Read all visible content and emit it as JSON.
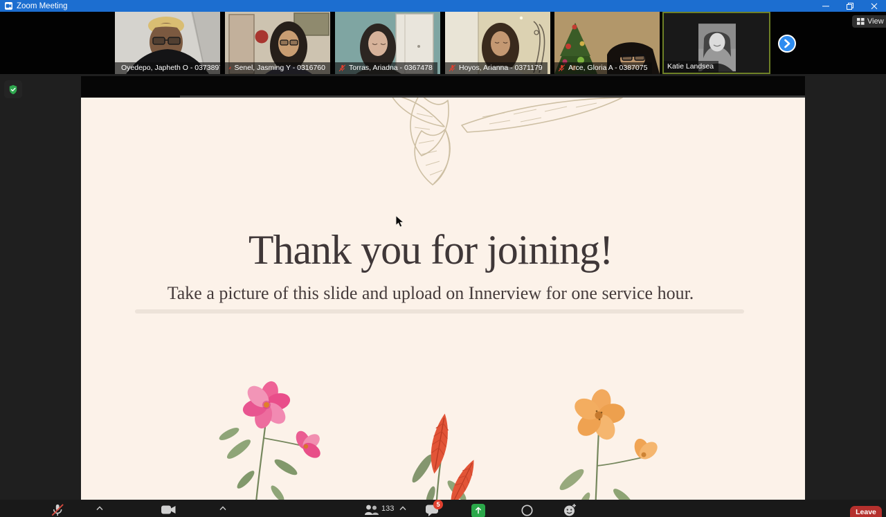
{
  "window": {
    "title": "Zoom Meeting"
  },
  "filmstrip": {
    "view_label": "View",
    "participants": [
      {
        "name": "Oyedepo, Japheth O - 0373897",
        "muted": true,
        "active_speaker": false
      },
      {
        "name": "Senel, Jasming Y - 0316760",
        "muted": true,
        "active_speaker": false
      },
      {
        "name": "Torras, Ariadna - 0367478",
        "muted": true,
        "active_speaker": false
      },
      {
        "name": "Hoyos, Arianna - 0371179",
        "muted": true,
        "active_speaker": false
      },
      {
        "name": "Arce, Gloria A - 0387075",
        "muted": true,
        "active_speaker": false
      },
      {
        "name": "Katie Landsea",
        "muted": false,
        "active_speaker": true
      }
    ]
  },
  "slide": {
    "title": "Thank you for joining!",
    "subtitle": "Take a picture of this slide and upload on Innerview for one service hour."
  },
  "toolbar": {
    "participants_count": "133",
    "chat_badge_count": "5",
    "leave_label": "Leave"
  },
  "icons": [
    "zoom-camera-icon",
    "minimize-icon",
    "restore-icon",
    "close-icon",
    "security-shield-icon",
    "muted-mic-icon",
    "next-participants-icon",
    "view-grid-icon",
    "microphone-muted-icon",
    "chevron-up-icon",
    "video-camera-icon",
    "participants-icon",
    "chat-icon",
    "share-screen-icon",
    "record-icon",
    "reactions-icon",
    "cursor-arrow"
  ],
  "colors": {
    "titlebar_blue": "#1c6ed0",
    "active_speaker_border": "#6e8026",
    "slide_background": "#fcf2e9",
    "share_green": "#2ba84a",
    "badge_red": "#e0402f",
    "leave_red": "#b5302d",
    "next_button_blue": "#2e8cf0",
    "shield_green": "#2fa84f"
  }
}
